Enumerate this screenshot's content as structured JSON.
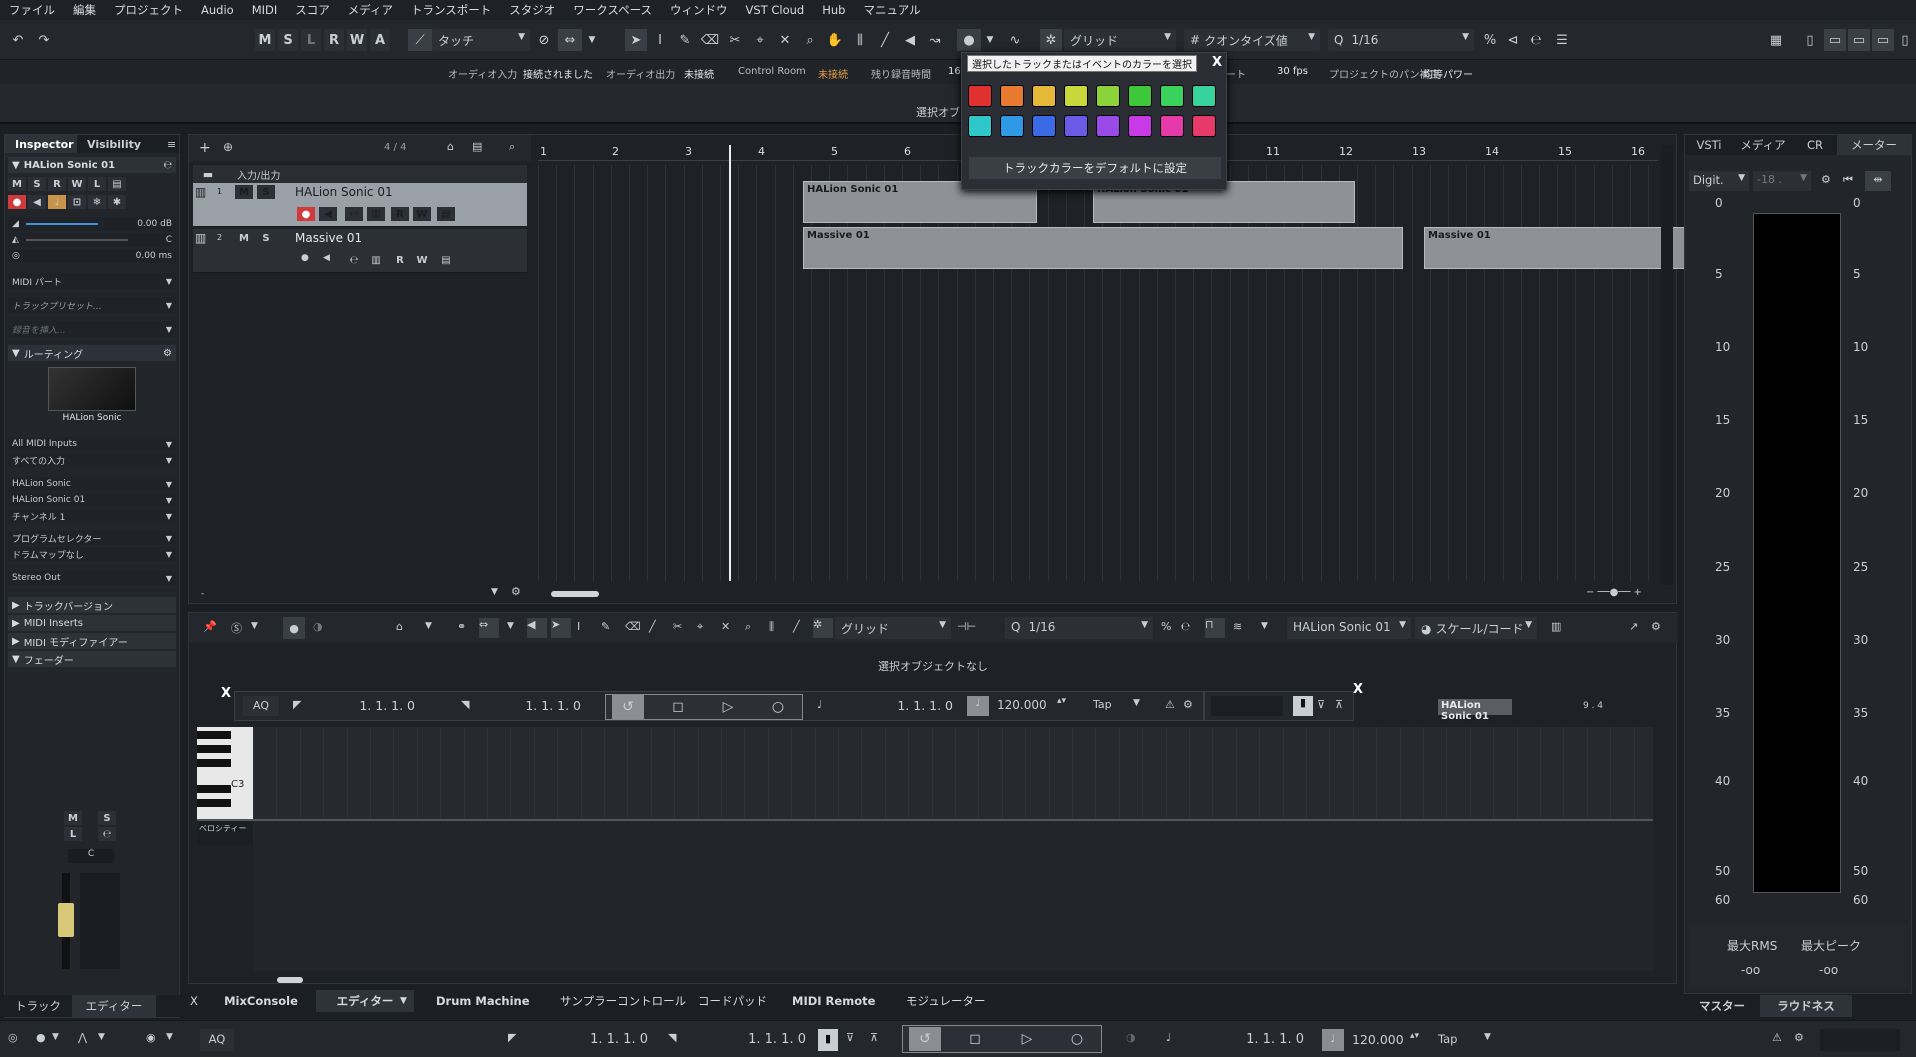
{
  "menu": [
    "ファイル",
    "編集",
    "プロジェクト",
    "Audio",
    "MIDI",
    "スコア",
    "メディア",
    "トランスポート",
    "スタジオ",
    "ワークスペース",
    "ウィンドウ",
    "VST Cloud",
    "Hub",
    "マニュアル"
  ],
  "toolbar": {
    "msrwa": [
      "M",
      "S",
      "L",
      "R",
      "W",
      "A"
    ],
    "automation_mode": "タッチ",
    "snap_label": "グリッド",
    "quantize_type": "クオンタイズ値",
    "quantize_value": "1/16"
  },
  "status": {
    "audio_in_label": "オーディオ入力",
    "audio_in_value": "接続されました",
    "audio_out_label": "オーディオ出力",
    "audio_out_value": "未接続",
    "control_room_label": "Control Room",
    "control_room_value": "未接続",
    "record_time_label": "残り録音時間",
    "record_time_value": "16",
    "rate_suffix": "ート",
    "fps": "30 fps",
    "pan_label": "プロジェクトのパン補正",
    "pan_value": "均等パワー"
  },
  "info_line": "選択オブ",
  "color_popup": {
    "tooltip": "選択したトラックまたはイベントのカラーを選択",
    "close": "X",
    "reset": "トラックカラーをデフォルトに設定",
    "colors": [
      "#e03030",
      "#e87a30",
      "#e6b83a",
      "#c8d83a",
      "#8cd23a",
      "#3cc83a",
      "#3ad25a",
      "#3ad29c",
      "#2ec8c8",
      "#2e9ae6",
      "#3a6ae6",
      "#6a5ae6",
      "#9a4ae6",
      "#c83ae6",
      "#e63aa8",
      "#e63a6a"
    ]
  },
  "inspector": {
    "tab_inspector": "Inspector",
    "tab_visibility": "Visibility",
    "track_name": "HALion Sonic 01",
    "buttons": [
      "M",
      "S",
      "R",
      "W",
      "L"
    ],
    "volume": "0.00 dB",
    "pan": "C",
    "delay": "0.00 ms",
    "midi_part": "MIDI パート",
    "track_preset": "トラックプリセット...",
    "insert_placeholder": "録音を挿入...",
    "routing": "ルーティング",
    "instrument": "HALion Sonic",
    "midi_in": "All MIDI Inputs",
    "all_inputs": "すべての入力",
    "out_inst": "HALion Sonic",
    "out_track": "HALion Sonic 01",
    "channel": "チャンネル 1",
    "program_sel": "プログラムセレクター",
    "drum_map": "ドラムマップなし",
    "stereo_out": "Stereo Out",
    "sections": [
      "トラックバージョン",
      "MIDI Inserts",
      "MIDI モディファイアー",
      "フェーダー"
    ],
    "fader_btns": [
      "M",
      "S",
      "L"
    ],
    "pan_center": "C",
    "tab_track": "トラック",
    "tab_editor": "エディター"
  },
  "project": {
    "time_sig": "4 / 4",
    "folder": "入力/出力",
    "tracks": [
      {
        "num": "1",
        "name": "HALion Sonic 01"
      },
      {
        "num": "2",
        "name": "Massive 01"
      }
    ],
    "ruler": [
      "1",
      "2",
      "3",
      "4",
      "5",
      "6",
      "11",
      "12",
      "13",
      "14",
      "15",
      "16"
    ],
    "events": [
      "HALion Sonic 01",
      "HALion Sonic 01",
      "Massive 01",
      "Massive 01"
    ]
  },
  "editor": {
    "snap": "グリッド",
    "quantize": "1/16",
    "track": "HALion Sonic 01",
    "scale": "スケール/コード",
    "no_selection": "選択オブジェクトなし",
    "aq": "AQ",
    "pos_left": "1. 1. 1.  0",
    "pos_right": "1. 1. 1.  0",
    "pos_cur": "1. 1. 1.  0",
    "tempo": "120.000",
    "tap": "Tap",
    "part_label": "HALion Sonic 01",
    "pos_marker": "9 . 4",
    "note_c3": "C3",
    "velocity": "ベロシティー",
    "close": "X"
  },
  "lower_tabs": {
    "close": "X",
    "mixconsole": "MixConsole",
    "editor": "エディター",
    "drum_machine": "Drum Machine",
    "sampler": "サンプラーコントロール",
    "chord_pads": "コードパッド",
    "midi_remote": "MIDI Remote",
    "modulator": "モジュレーター"
  },
  "right": {
    "tabs": [
      "VSTi",
      "メディア",
      "CR",
      "メーター"
    ],
    "meter_type": "Digit.",
    "meter_val": "-18 .",
    "scale": [
      "0",
      "5",
      "10",
      "15",
      "20",
      "25",
      "30",
      "35",
      "40",
      "50",
      "60"
    ],
    "max_rms_label": "最大RMS",
    "max_peak_label": "最大ピーク",
    "max_rms": "-oo",
    "max_peak": "-oo",
    "tab_master": "マスター",
    "tab_loudness": "ラウドネス"
  },
  "transport": {
    "aq": "AQ",
    "left": "1. 1. 1.  0",
    "right": "1. 1. 1.  0",
    "pos": "1. 1. 1.  0",
    "tempo": "120.000",
    "tap": "Tap"
  }
}
